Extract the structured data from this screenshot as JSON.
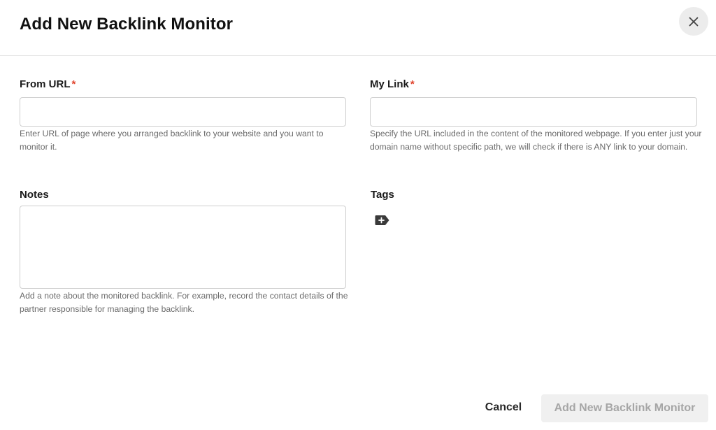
{
  "dialog": {
    "title": "Add New Backlink Monitor",
    "close_icon": "close-icon"
  },
  "from_url": {
    "label": "From URL",
    "required_mark": "*",
    "value": "",
    "placeholder": "",
    "help": "Enter URL of page where you arranged backlink to your website and you want to monitor it."
  },
  "my_link": {
    "label": "My Link",
    "required_mark": "*",
    "value": "",
    "placeholder": "",
    "help": "Specify the URL included in the content of the monitored webpage. If you enter just your domain name without specific path, we will check if there is ANY link to your domain."
  },
  "notes": {
    "label": "Notes",
    "value": "",
    "placeholder": "",
    "help": "Add a note about the monitored backlink. For example, record the contact details of the partner responsible for managing the backlink."
  },
  "tags": {
    "label": "Tags",
    "add_icon": "add-tag-icon"
  },
  "footer": {
    "cancel_label": "Cancel",
    "submit_label": "Add New Backlink Monitor"
  },
  "colors": {
    "required": "#e0442d",
    "submit_disabled_bg": "#f0f0f0",
    "submit_disabled_text": "#a6a6a6",
    "close_bg": "#ececec"
  }
}
